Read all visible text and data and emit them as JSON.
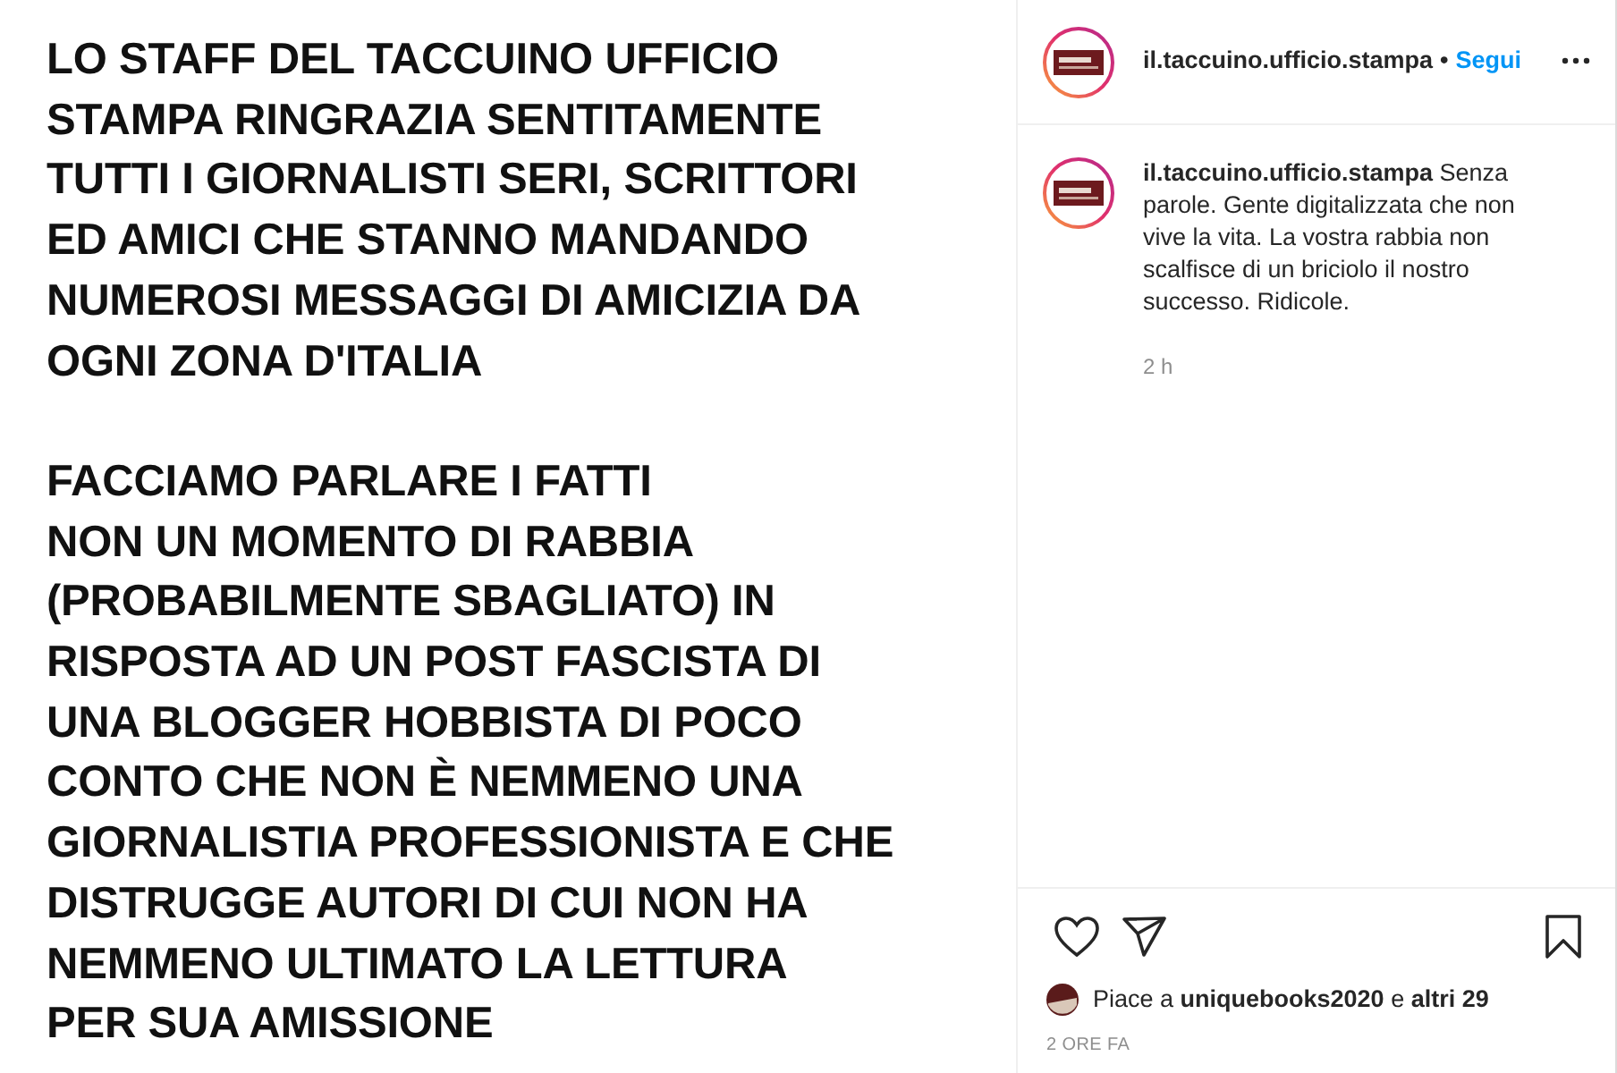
{
  "post_image": {
    "paragraphs": [
      [
        "LO STAFF DEL TACCUINO UFFICIO",
        "STAMPA RINGRAZIA SENTITAMENTE",
        "TUTTI I GIORNALISTI SERI, SCRITTORI",
        "ED AMICI CHE STANNO MANDANDO",
        "NUMEROSI MESSAGGI DI AMICIZIA DA",
        "OGNI ZONA D'ITALIA"
      ],
      [
        "FACCIAMO PARLARE I FATTI",
        "NON UN MOMENTO DI RABBIA",
        "(PROBABILMENTE SBAGLIATO) IN",
        "RISPOSTA AD UN POST FASCISTA  DI",
        "UNA BLOGGER HOBBISTA DI POCO",
        "CONTO CHE NON È NEMMENO UNA",
        "GIORNALISTIA PROFESSIONISTA E CHE",
        "DISTRUGGE AUTORI DI CUI NON HA",
        "NEMMENO ULTIMATO LA LETTURA",
        "PER SUA AMISSIONE"
      ]
    ]
  },
  "header": {
    "username": "il.taccuino.ufficio.stampa",
    "separator": "•",
    "follow": "Segui"
  },
  "caption": {
    "text": "**il.taccuino.ufficio.stampa** Senza parole. Gente digitalizzata che non vive la vita. La vostra rabbia non scalfisce di un briciolo il nostro successo. Ridicole.",
    "time": "2 h"
  },
  "likes": {
    "text": "Piace a **uniquebooks2020** e **altri 29**"
  },
  "timestamp": "2 ORE FA"
}
